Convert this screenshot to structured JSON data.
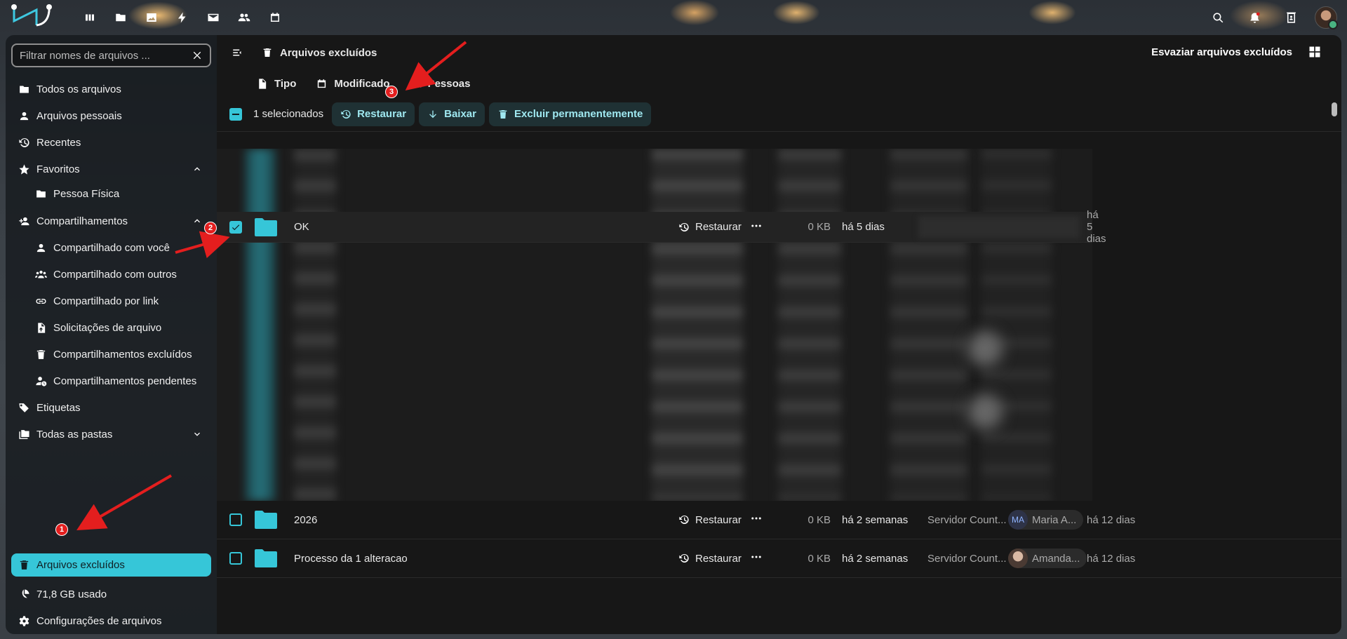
{
  "colors": {
    "accent": "#36c6d8",
    "annotation": "#e41e1e"
  },
  "sidebar": {
    "filter_placeholder": "Filtrar nomes de arquivos ...",
    "items": {
      "all_files": "Todos os arquivos",
      "personal_files": "Arquivos pessoais",
      "recent": "Recentes",
      "favorites": "Favoritos",
      "fav_folder": "Pessoa Física",
      "shares": "Compartilhamentos",
      "shared_with_you": "Compartilhado com você",
      "shared_with_others": "Compartilhado com outros",
      "shared_by_link": "Compartilhado por link",
      "file_requests": "Solicitações de arquivo",
      "deleted_shares": "Compartilhamentos excluídos",
      "pending_shares": "Compartilhamentos pendentes",
      "tags": "Etiquetas",
      "all_folders": "Todas as pastas"
    },
    "deleted_files": "Arquivos excluídos",
    "usage": "71,8 GB usado",
    "settings": "Configurações de arquivos"
  },
  "header": {
    "breadcrumb": "Arquivos excluídos",
    "empty_trash": "Esvaziar arquivos excluídos"
  },
  "filters": {
    "type": "Tipo",
    "modified": "Modificado",
    "people": "Pessoas"
  },
  "actions": {
    "selected": "1 selecionados",
    "restore": "Restaurar",
    "download": "Baixar",
    "delete_permanently": "Excluir permanentemente"
  },
  "rows": [
    {
      "name": "OK",
      "restore": "Restaurar",
      "size": "0 KB",
      "deleted": "há 5 dias",
      "origin": "",
      "by": "",
      "by_initials": "",
      "date2": "há 5 dias"
    },
    {
      "name": "2026",
      "restore": "Restaurar",
      "size": "0 KB",
      "deleted": "há 2 semanas",
      "origin": "Servidor Count...",
      "by": "Maria A...",
      "by_initials": "MA",
      "date2": "há 12 dias"
    },
    {
      "name": "Processo da 1 alteracao",
      "restore": "Restaurar",
      "size": "0 KB",
      "deleted": "há 2 semanas",
      "origin": "Servidor Count...",
      "by": "Amanda...",
      "by_initials": "",
      "date2": "há 12 dias"
    }
  ],
  "annotations": {
    "m1": "1",
    "m2": "2",
    "m3": "3"
  }
}
